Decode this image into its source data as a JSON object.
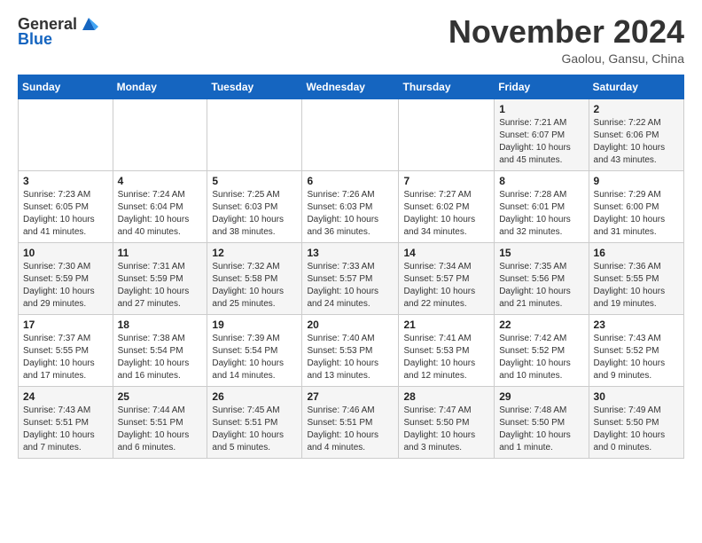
{
  "header": {
    "logo_line1": "General",
    "logo_line2": "Blue",
    "month_title": "November 2024",
    "location": "Gaolou, Gansu, China"
  },
  "days_of_week": [
    "Sunday",
    "Monday",
    "Tuesday",
    "Wednesday",
    "Thursday",
    "Friday",
    "Saturday"
  ],
  "weeks": [
    [
      {
        "day": "",
        "info": ""
      },
      {
        "day": "",
        "info": ""
      },
      {
        "day": "",
        "info": ""
      },
      {
        "day": "",
        "info": ""
      },
      {
        "day": "",
        "info": ""
      },
      {
        "day": "1",
        "info": "Sunrise: 7:21 AM\nSunset: 6:07 PM\nDaylight: 10 hours and 45 minutes."
      },
      {
        "day": "2",
        "info": "Sunrise: 7:22 AM\nSunset: 6:06 PM\nDaylight: 10 hours and 43 minutes."
      }
    ],
    [
      {
        "day": "3",
        "info": "Sunrise: 7:23 AM\nSunset: 6:05 PM\nDaylight: 10 hours and 41 minutes."
      },
      {
        "day": "4",
        "info": "Sunrise: 7:24 AM\nSunset: 6:04 PM\nDaylight: 10 hours and 40 minutes."
      },
      {
        "day": "5",
        "info": "Sunrise: 7:25 AM\nSunset: 6:03 PM\nDaylight: 10 hours and 38 minutes."
      },
      {
        "day": "6",
        "info": "Sunrise: 7:26 AM\nSunset: 6:03 PM\nDaylight: 10 hours and 36 minutes."
      },
      {
        "day": "7",
        "info": "Sunrise: 7:27 AM\nSunset: 6:02 PM\nDaylight: 10 hours and 34 minutes."
      },
      {
        "day": "8",
        "info": "Sunrise: 7:28 AM\nSunset: 6:01 PM\nDaylight: 10 hours and 32 minutes."
      },
      {
        "day": "9",
        "info": "Sunrise: 7:29 AM\nSunset: 6:00 PM\nDaylight: 10 hours and 31 minutes."
      }
    ],
    [
      {
        "day": "10",
        "info": "Sunrise: 7:30 AM\nSunset: 5:59 PM\nDaylight: 10 hours and 29 minutes."
      },
      {
        "day": "11",
        "info": "Sunrise: 7:31 AM\nSunset: 5:59 PM\nDaylight: 10 hours and 27 minutes."
      },
      {
        "day": "12",
        "info": "Sunrise: 7:32 AM\nSunset: 5:58 PM\nDaylight: 10 hours and 25 minutes."
      },
      {
        "day": "13",
        "info": "Sunrise: 7:33 AM\nSunset: 5:57 PM\nDaylight: 10 hours and 24 minutes."
      },
      {
        "day": "14",
        "info": "Sunrise: 7:34 AM\nSunset: 5:57 PM\nDaylight: 10 hours and 22 minutes."
      },
      {
        "day": "15",
        "info": "Sunrise: 7:35 AM\nSunset: 5:56 PM\nDaylight: 10 hours and 21 minutes."
      },
      {
        "day": "16",
        "info": "Sunrise: 7:36 AM\nSunset: 5:55 PM\nDaylight: 10 hours and 19 minutes."
      }
    ],
    [
      {
        "day": "17",
        "info": "Sunrise: 7:37 AM\nSunset: 5:55 PM\nDaylight: 10 hours and 17 minutes."
      },
      {
        "day": "18",
        "info": "Sunrise: 7:38 AM\nSunset: 5:54 PM\nDaylight: 10 hours and 16 minutes."
      },
      {
        "day": "19",
        "info": "Sunrise: 7:39 AM\nSunset: 5:54 PM\nDaylight: 10 hours and 14 minutes."
      },
      {
        "day": "20",
        "info": "Sunrise: 7:40 AM\nSunset: 5:53 PM\nDaylight: 10 hours and 13 minutes."
      },
      {
        "day": "21",
        "info": "Sunrise: 7:41 AM\nSunset: 5:53 PM\nDaylight: 10 hours and 12 minutes."
      },
      {
        "day": "22",
        "info": "Sunrise: 7:42 AM\nSunset: 5:52 PM\nDaylight: 10 hours and 10 minutes."
      },
      {
        "day": "23",
        "info": "Sunrise: 7:43 AM\nSunset: 5:52 PM\nDaylight: 10 hours and 9 minutes."
      }
    ],
    [
      {
        "day": "24",
        "info": "Sunrise: 7:43 AM\nSunset: 5:51 PM\nDaylight: 10 hours and 7 minutes."
      },
      {
        "day": "25",
        "info": "Sunrise: 7:44 AM\nSunset: 5:51 PM\nDaylight: 10 hours and 6 minutes."
      },
      {
        "day": "26",
        "info": "Sunrise: 7:45 AM\nSunset: 5:51 PM\nDaylight: 10 hours and 5 minutes."
      },
      {
        "day": "27",
        "info": "Sunrise: 7:46 AM\nSunset: 5:51 PM\nDaylight: 10 hours and 4 minutes."
      },
      {
        "day": "28",
        "info": "Sunrise: 7:47 AM\nSunset: 5:50 PM\nDaylight: 10 hours and 3 minutes."
      },
      {
        "day": "29",
        "info": "Sunrise: 7:48 AM\nSunset: 5:50 PM\nDaylight: 10 hours and 1 minute."
      },
      {
        "day": "30",
        "info": "Sunrise: 7:49 AM\nSunset: 5:50 PM\nDaylight: 10 hours and 0 minutes."
      }
    ]
  ]
}
